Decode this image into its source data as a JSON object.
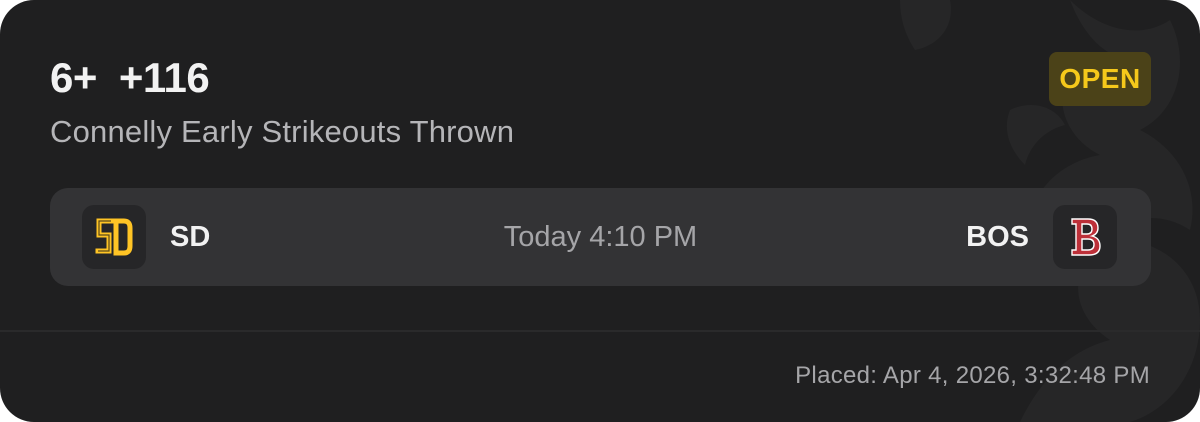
{
  "bet": {
    "selection": "6+",
    "odds": "+116",
    "market": "Connelly Early Strikeouts Thrown",
    "status": "OPEN"
  },
  "game": {
    "home_team": "SD",
    "away_team": "BOS",
    "time": "Today 4:10 PM",
    "home_logo_icon": "padres-sd-logo-icon",
    "away_logo_icon": "red-sox-b-logo-icon"
  },
  "placed": "Placed: Apr 4, 2026, 3:32:48 PM",
  "colors": {
    "card_background": "#1f1f20",
    "matchup_background": "#333335",
    "status_text": "#f5c81b",
    "status_background": "#4b4218",
    "padres_gold": "#ffc425",
    "red_sox_red": "#bd3039"
  }
}
